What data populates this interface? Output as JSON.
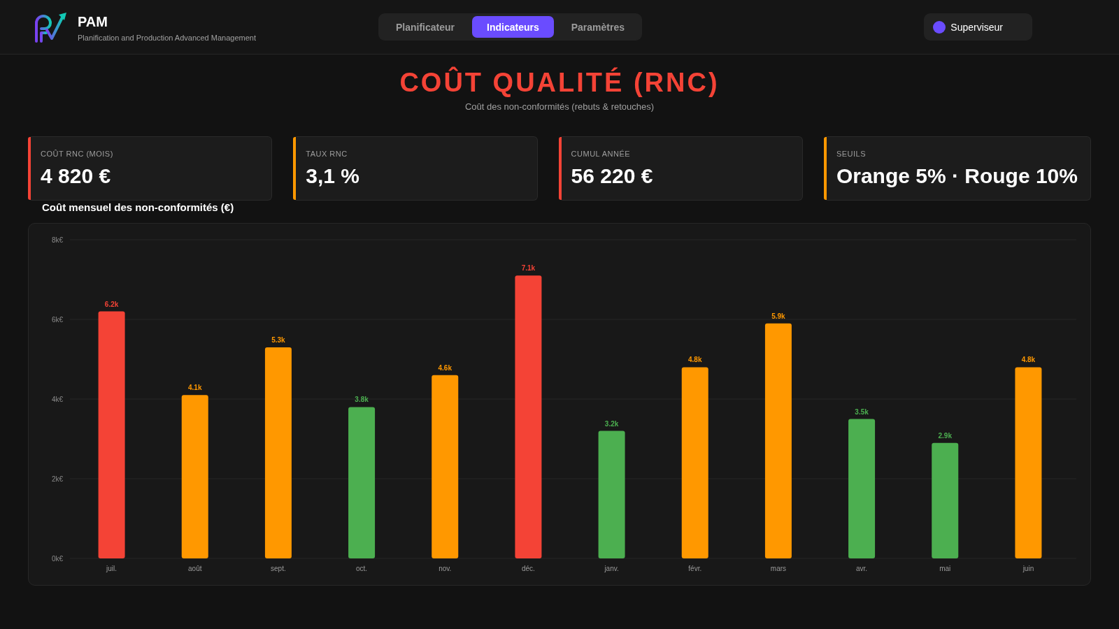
{
  "header": {
    "title": "PAM",
    "subtitle": "Planification and Production Advanced Management"
  },
  "tabs": [
    {
      "label": "Planificateur",
      "selected": false
    },
    {
      "label": "Indicateurs",
      "selected": true
    },
    {
      "label": "Paramètres",
      "selected": false
    }
  ],
  "user": {
    "label": "Superviseur"
  },
  "page": {
    "title": "COÛT QUALITÉ (RNC)",
    "subtitle": "Coût des non-conformités (rebuts & retouches)"
  },
  "kpis": [
    {
      "label": "COÛT RNC (MOIS)",
      "value": "4 820 €",
      "color": "#f44336"
    },
    {
      "label": "TAUX RNC",
      "value": "3,1 %",
      "color": "#ff9800"
    },
    {
      "label": "CUMUL ANNÉE",
      "value": "56 220 €",
      "color": "#f44336"
    },
    {
      "label": "SEUILS",
      "value": "Orange 5% · Rouge 10%",
      "color": "#ff9800"
    }
  ],
  "chart": {
    "chart_data": {
      "type": "bar",
      "title": "Coût mensuel des non-conformités (€)",
      "categories": [
        "juil.",
        "août",
        "sept.",
        "oct.",
        "nov.",
        "déc.",
        "janv.",
        "févr.",
        "mars",
        "avr.",
        "mai",
        "juin"
      ],
      "values": [
        6200,
        4100,
        5300,
        3800,
        4600,
        7100,
        3200,
        4800,
        5900,
        3500,
        2900,
        4800
      ],
      "colors": [
        "#f44336",
        "#ff9800",
        "#ff9800",
        "#4caf50",
        "#ff9800",
        "#f44336",
        "#4caf50",
        "#ff9800",
        "#ff9800",
        "#4caf50",
        "#4caf50",
        "#ff9800"
      ],
      "value_labels": [
        "6.2k",
        "4.1k",
        "5.3k",
        "3.8k",
        "4.6k",
        "7.1k",
        "3.2k",
        "4.8k",
        "5.9k",
        "3.5k",
        "2.9k",
        "4.8k"
      ],
      "grid": true,
      "ylim": [
        0,
        8000
      ],
      "yticks": [
        {
          "value": 0,
          "label": "0k€"
        },
        {
          "value": 2000,
          "label": "2k€"
        },
        {
          "value": 4000,
          "label": "4k€"
        },
        {
          "value": 6000,
          "label": "6k€"
        },
        {
          "value": 8000,
          "label": "8k€"
        }
      ]
    }
  }
}
